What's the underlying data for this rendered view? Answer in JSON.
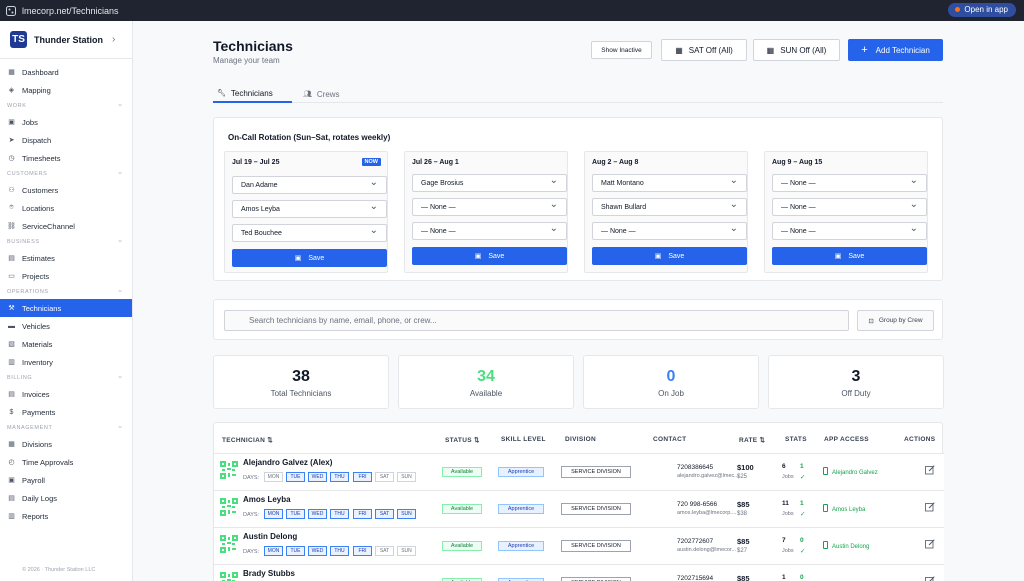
{
  "browser": {
    "url": "lmecorp.net/Technicians",
    "open_app": "Open in app"
  },
  "sidebar": {
    "brand": "Thunder Station",
    "logo_text": "TS",
    "groups": [
      {
        "title": "",
        "items": [
          {
            "label": "Dashboard",
            "icon": "grid-icon"
          },
          {
            "label": "Mapping",
            "icon": "map-icon"
          }
        ]
      },
      {
        "title": "WORK",
        "items": [
          {
            "label": "Jobs",
            "icon": "briefcase-icon"
          },
          {
            "label": "Dispatch",
            "icon": "send-icon"
          },
          {
            "label": "Timesheets",
            "icon": "clock-icon"
          }
        ]
      },
      {
        "title": "CUSTOMERS",
        "items": [
          {
            "label": "Customers",
            "icon": "users-icon"
          },
          {
            "label": "Locations",
            "icon": "pin-icon"
          },
          {
            "label": "ServiceChannel",
            "icon": "link-icon"
          }
        ]
      },
      {
        "title": "BUSINESS",
        "items": [
          {
            "label": "Estimates",
            "icon": "file-icon"
          },
          {
            "label": "Projects",
            "icon": "folder-icon"
          }
        ]
      },
      {
        "title": "OPERATIONS",
        "items": [
          {
            "label": "Technicians",
            "icon": "wrench-icon",
            "active": true
          },
          {
            "label": "Vehicles",
            "icon": "truck-icon"
          },
          {
            "label": "Materials",
            "icon": "box-icon"
          },
          {
            "label": "Inventory",
            "icon": "archive-icon"
          }
        ]
      },
      {
        "title": "BILLING",
        "items": [
          {
            "label": "Invoices",
            "icon": "invoice-icon"
          },
          {
            "label": "Payments",
            "icon": "dollar-icon"
          }
        ]
      },
      {
        "title": "MANAGEMENT",
        "items": [
          {
            "label": "Divisions",
            "icon": "division-icon"
          },
          {
            "label": "Time Approvals",
            "icon": "check-clock-icon"
          },
          {
            "label": "Payroll",
            "icon": "payroll-icon"
          },
          {
            "label": "Daily Logs",
            "icon": "log-icon"
          },
          {
            "label": "Reports",
            "icon": "report-icon"
          }
        ]
      }
    ],
    "copyright": "© 2026 · Thunder Station LLC"
  },
  "header": {
    "title": "Technicians",
    "subtitle": "Manage your team",
    "show_inactive": "Show Inactive",
    "sat_off": "SAT Off (All)",
    "sun_off": "SUN Off (All)",
    "add": "Add Technician"
  },
  "tabs": {
    "technicians": "Technicians",
    "crews": "Crews"
  },
  "oncall": {
    "title": "On-Call Rotation (Sun–Sat, rotates weekly)",
    "now_badge": "NOW",
    "save": "Save",
    "weeks": [
      {
        "range": "Jul 19 – Jul 25",
        "now": true,
        "slots": [
          "Dan Adame",
          "Amos Leyba",
          "Ted Bouchee"
        ]
      },
      {
        "range": "Jul 26 – Aug 1",
        "now": false,
        "slots": [
          "Gage Brosius",
          "— None —",
          "— None —"
        ]
      },
      {
        "range": "Aug 2 – Aug 8",
        "now": false,
        "slots": [
          "Matt Montano",
          "Shawn Bullard",
          "— None —"
        ]
      },
      {
        "range": "Aug 9 – Aug 15",
        "now": false,
        "slots": [
          "— None —",
          "— None —",
          "— None —"
        ]
      }
    ]
  },
  "search": {
    "placeholder": "Search technicians by name, email, phone, or crew...",
    "group_by_crew": "Group by Crew"
  },
  "stats": [
    {
      "value": "38",
      "label": "Total Technicians",
      "color": "#111827"
    },
    {
      "value": "34",
      "label": "Available",
      "color": "#4ade80"
    },
    {
      "value": "0",
      "label": "On Job",
      "color": "#3b82f6"
    },
    {
      "value": "3",
      "label": "Off Duty",
      "color": "#111827"
    }
  ],
  "table": {
    "headers": {
      "technician": "TECHNICIAN ⇅",
      "status": "STATUS ⇅",
      "skill": "SKILL LEVEL",
      "division": "DIVISION",
      "contact": "CONTACT",
      "rate": "RATE ⇅",
      "stats": "STATS",
      "access": "APP ACCESS",
      "actions": "ACTIONS"
    },
    "days_label": "DAYS:",
    "day_names": [
      "MON",
      "TUE",
      "WED",
      "THU",
      "FRI",
      "SAT",
      "SUN"
    ],
    "rows": [
      {
        "name": "Alejandro Galvez (Alex)",
        "days_on": [
          0,
          1,
          1,
          1,
          1,
          0,
          0
        ],
        "status": "Available",
        "skill": "Apprentice",
        "division": "SERVICE DIVISION",
        "phone": "7208386645",
        "email": "alejandro.galvez@lmec...",
        "rate": "$100",
        "rate_sub": "$25",
        "jobs": "6",
        "jobs_label": "Jobs",
        "done": "1",
        "check": "✓",
        "access": "Alejandro Galvez"
      },
      {
        "name": "Amos Leyba",
        "days_on": [
          1,
          1,
          1,
          1,
          1,
          1,
          1
        ],
        "status": "Available",
        "skill": "Apprentice",
        "division": "SERVICE DIVISION",
        "phone": "720 998-6566",
        "email": "amos.leyba@lmecorp....",
        "rate": "$85",
        "rate_sub": "$38",
        "jobs": "11",
        "jobs_label": "Jobs",
        "done": "1",
        "check": "✓",
        "access": "Amos Leyba"
      },
      {
        "name": "Austin Delong",
        "days_on": [
          1,
          1,
          1,
          1,
          1,
          0,
          0
        ],
        "status": "Available",
        "skill": "Apprentice",
        "division": "SERVICE DIVISION",
        "phone": "7202772607",
        "email": "austin.delong@lmecor...",
        "rate": "$85",
        "rate_sub": "$27",
        "jobs": "7",
        "jobs_label": "Jobs",
        "done": "0",
        "check": "✓",
        "access": "Austin Delong"
      },
      {
        "name": "Brady Stubbs",
        "days_on": [
          0,
          0,
          0,
          0,
          0,
          0,
          0
        ],
        "status": "Available",
        "skill": "Apprentice",
        "division": "SERVICE DIVISION",
        "phone": "7202715694",
        "email": "",
        "rate": "$85",
        "rate_sub": "",
        "jobs": "1",
        "jobs_label": "Jobs",
        "done": "0",
        "check": "",
        "access": ""
      }
    ]
  }
}
